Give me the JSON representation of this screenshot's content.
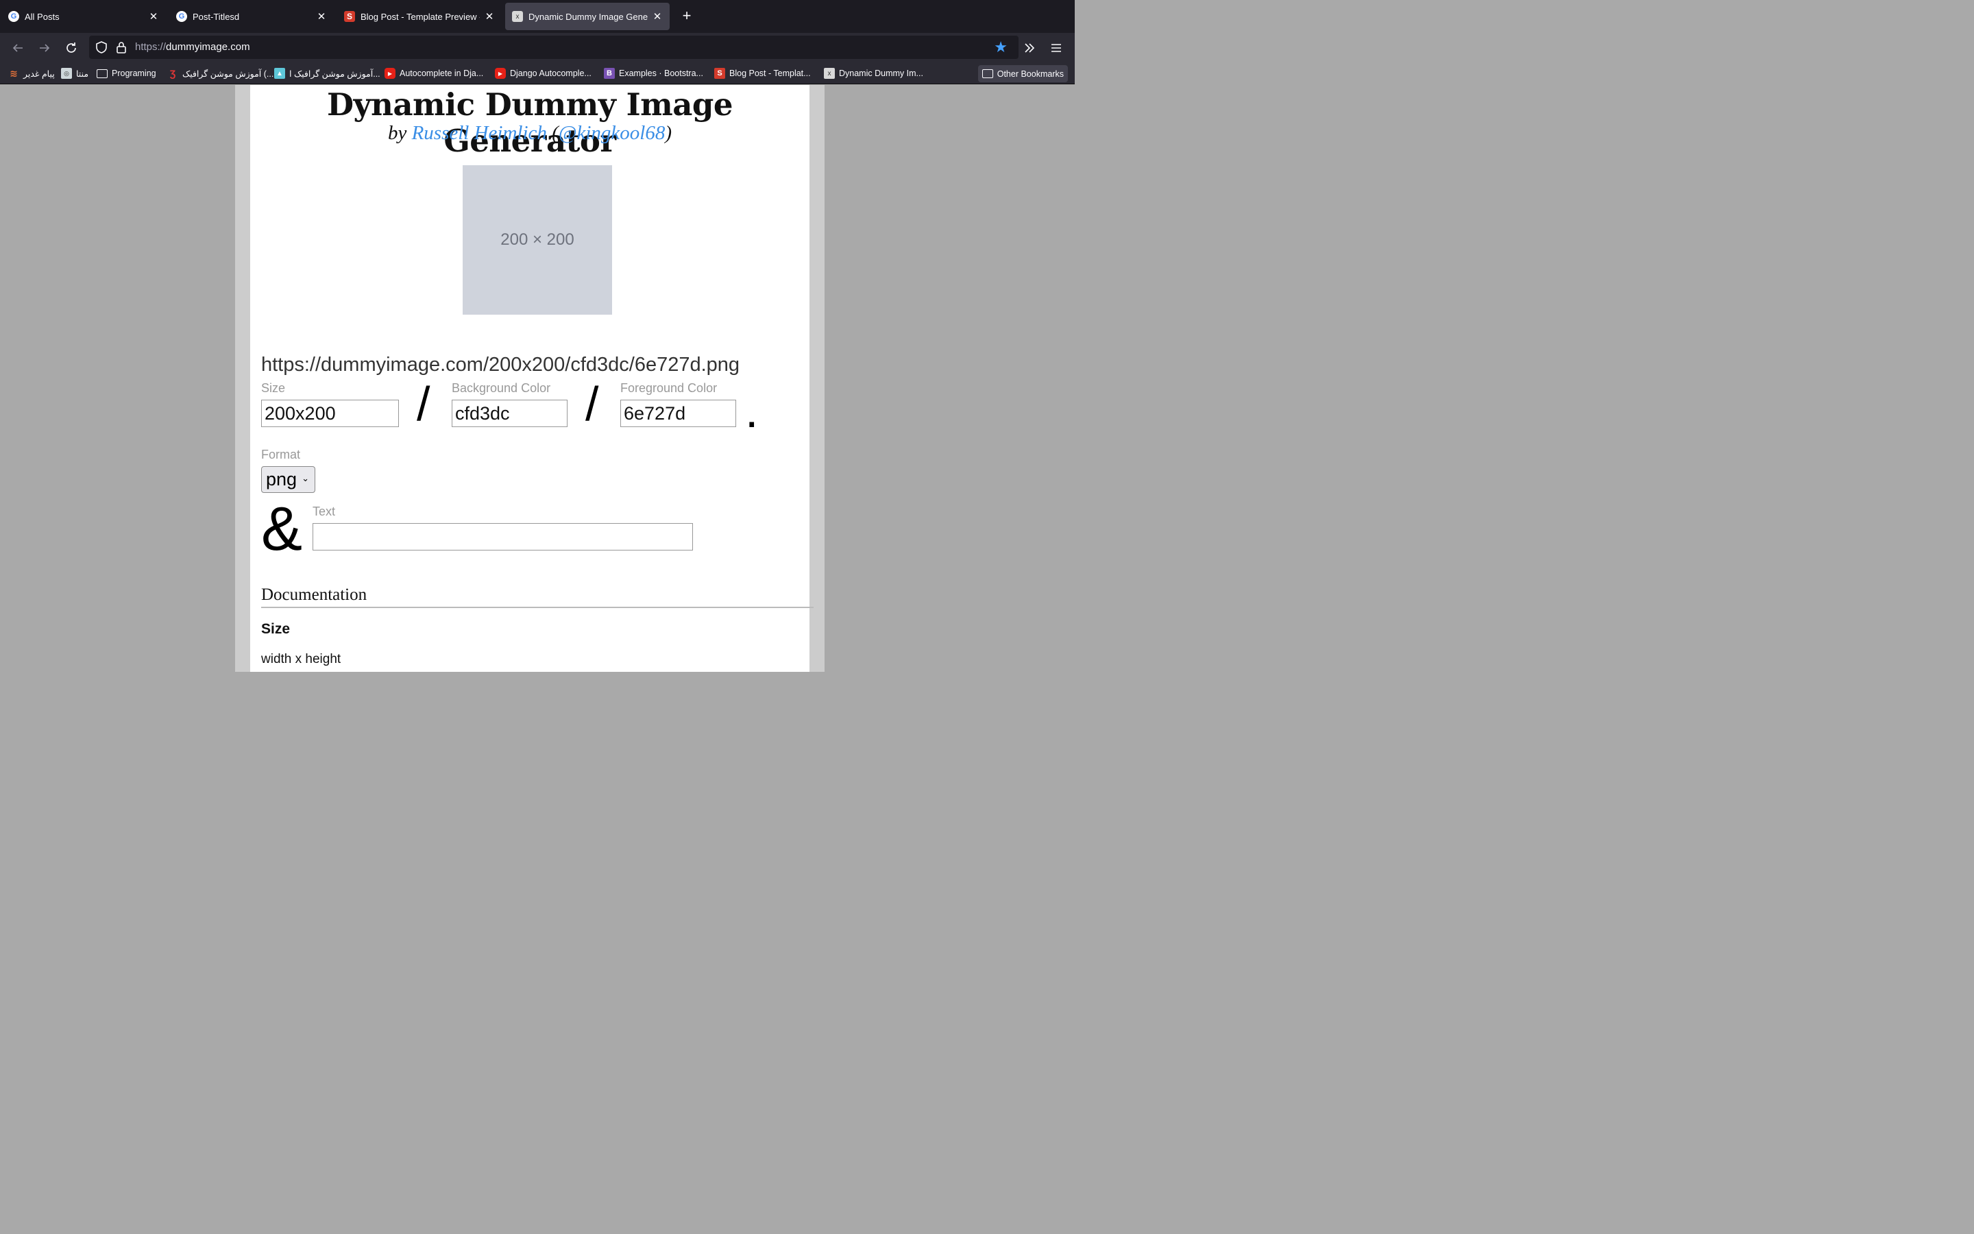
{
  "browser": {
    "tabs": [
      {
        "title": "All Posts",
        "icon": "google-icon",
        "active": false
      },
      {
        "title": "Post-Titlesd",
        "icon": "google-icon",
        "active": false
      },
      {
        "title": "Blog Post - Template Preview - S",
        "icon": "s-icon",
        "active": false
      },
      {
        "title": "Dynamic Dummy Image Generat",
        "icon": "x-icon",
        "active": true
      }
    ],
    "new_tab": "+",
    "url_scheme": "https://",
    "url_host": "dummyimage.com",
    "bookmarks": [
      {
        "label": "پیام غدیر",
        "icon": "orange-s-icon"
      },
      {
        "label": "منتا",
        "icon": "menta-icon"
      },
      {
        "label": "Programing",
        "icon": "folder-icon"
      },
      {
        "label": "آموزش موشن گرافیک (...",
        "icon": "red-logo-icon"
      },
      {
        "label": "آموزش موشن گرافیک ا...",
        "icon": "teal-icon"
      },
      {
        "label": "Autocomplete in Dja...",
        "icon": "youtube-icon"
      },
      {
        "label": "Django Autocomple...",
        "icon": "youtube-icon"
      },
      {
        "label": "Examples · Bootstra...",
        "icon": "bootstrap-icon"
      },
      {
        "label": "Blog Post - Templat...",
        "icon": "s-icon"
      },
      {
        "label": "Dynamic Dummy Im...",
        "icon": "x-icon"
      }
    ],
    "other_bookmarks": "Other Bookmarks"
  },
  "page": {
    "title": "Dynamic Dummy Image Generator",
    "by": "by",
    "author": "Russell Heimlich",
    "paren_open": "(",
    "handle": "@kingkool68",
    "paren_close": ")",
    "preview_text": "200 × 200",
    "preview_bg": "#cfd3dc",
    "preview_fg": "#6e727d",
    "generated_url": "https://dummyimage.com/200x200/cfd3dc/6e727d.png",
    "size_label": "Size",
    "size_value": "200x200",
    "bg_label": "Background Color",
    "bg_value": "cfd3dc",
    "fg_label": "Foreground Color",
    "fg_value": "6e727d",
    "slash": "/",
    "period": ".",
    "format_label": "Format",
    "format_value": "png",
    "ampersand": "&",
    "text_label": "Text",
    "text_value": "",
    "doc_heading": "Documentation",
    "doc_size_heading": "Size",
    "doc_size_text": "width x height"
  }
}
